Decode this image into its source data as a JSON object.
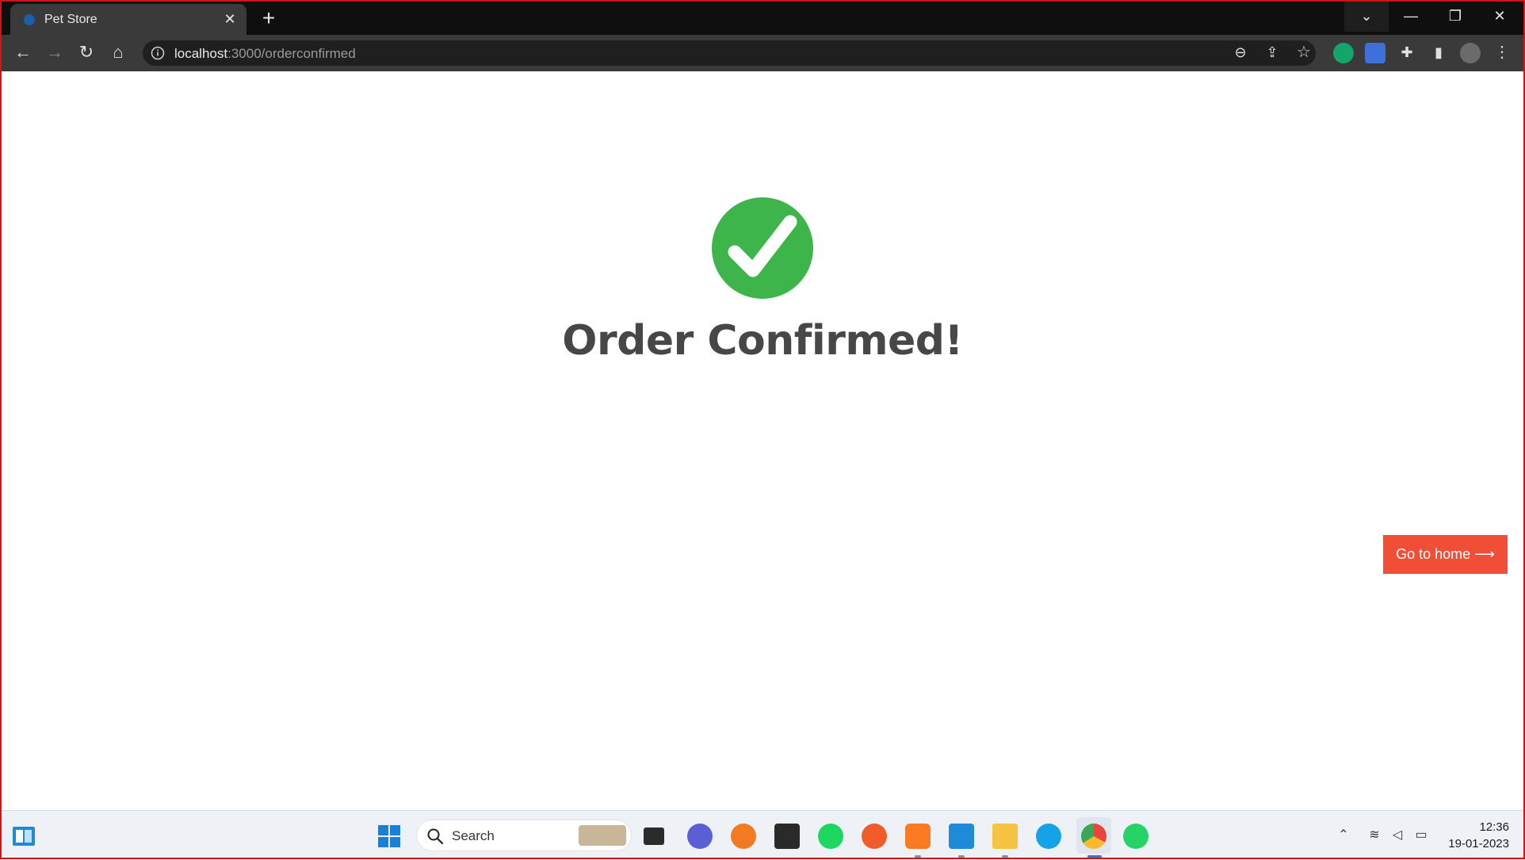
{
  "browser": {
    "tab_title": "Pet Store",
    "url_host": "localhost",
    "url_rest": ":3000/orderconfirmed"
  },
  "page": {
    "headline": "Order Confirmed!",
    "home_button": "Go to home ⟶",
    "accent_color": "#3db54a",
    "button_color": "#f04e37"
  },
  "taskbar": {
    "search_placeholder": "Search",
    "time": "12:36",
    "date": "19-01-2023"
  }
}
